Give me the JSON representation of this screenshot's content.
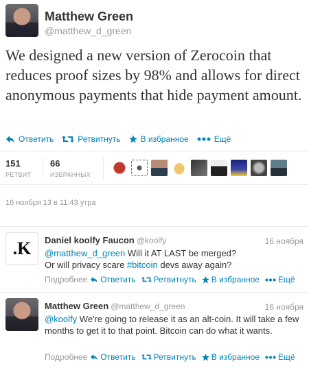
{
  "main_tweet": {
    "name": "Matthew Green",
    "handle": "@matthew_d_green",
    "text": "We designed a new version of Zerocoin that reduces proof sizes by 98% and allows for direct anonymous payments that hide payment amount.",
    "date": "16 ноября 13 в 11:43 утра"
  },
  "actions": {
    "reply": "Ответить",
    "retweet": "Ретвитнуть",
    "favorite": "В избранное",
    "more": "Ещё"
  },
  "stats": {
    "retweets_count": "151",
    "retweets_label": "РЕТВИТ",
    "favorites_count": "66",
    "favorites_label": "ИЗБРАННЫХ"
  },
  "replies": [
    {
      "name": "Daniel koolfy Faucon",
      "handle": "@koolfy",
      "date": "16 ноября",
      "mention": "@matthew_d_green",
      "text_line1": " Will it AT LAST be merged?",
      "text_line2_pre": "Or will privacy scare ",
      "hashtag": "#bitcoin",
      "text_line2_post": " devs away again?",
      "more_label": "Подробнее",
      "avatar_glyph": ".K"
    },
    {
      "name": "Matthew Green",
      "handle": "@matthew_d_green",
      "date": "16 ноября",
      "mention": "@koolfy",
      "text": " We're going to release it as an alt-coin. It will take a few months to get it to that point. Bitcoin can do what it wants.",
      "more_label": "Подробнее"
    }
  ],
  "colors": {
    "link": "#0084b4",
    "muted": "#999999",
    "text": "#333333"
  }
}
